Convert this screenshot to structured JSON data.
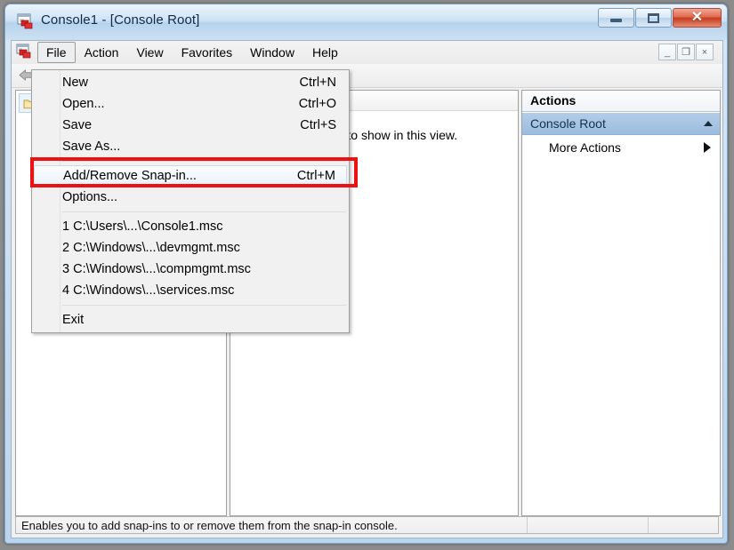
{
  "window": {
    "title": "Console1 - [Console Root]",
    "icon": "mmc-console-icon",
    "controls": {
      "minimize": "minimize-button",
      "maximize": "maximize-button",
      "close": "close-button"
    }
  },
  "mdi_controls": {
    "minimize": "_",
    "restore": "❐",
    "close": "×"
  },
  "menubar": {
    "items": [
      {
        "label": "File",
        "active": true
      },
      {
        "label": "Action",
        "active": false
      },
      {
        "label": "View",
        "active": false
      },
      {
        "label": "Favorites",
        "active": false
      },
      {
        "label": "Window",
        "active": false
      },
      {
        "label": "Help",
        "active": false
      }
    ]
  },
  "toolbar": {
    "back": "back-arrow-icon"
  },
  "file_menu": {
    "rows": [
      {
        "type": "item",
        "label": "New",
        "accel": "Ctrl+N",
        "highlight": false
      },
      {
        "type": "item",
        "label": "Open...",
        "accel": "Ctrl+O",
        "highlight": false
      },
      {
        "type": "item",
        "label": "Save",
        "accel": "Ctrl+S",
        "highlight": false
      },
      {
        "type": "item",
        "label": "Save As...",
        "accel": "",
        "highlight": false
      },
      {
        "type": "sep"
      },
      {
        "type": "item",
        "label": "Add/Remove Snap-in...",
        "accel": "Ctrl+M",
        "highlight": true
      },
      {
        "type": "item",
        "label": "Options...",
        "accel": "",
        "highlight": false
      },
      {
        "type": "sep"
      },
      {
        "type": "item",
        "label": "1 C:\\Users\\...\\Console1.msc",
        "accel": "",
        "highlight": false
      },
      {
        "type": "item",
        "label": "2 C:\\Windows\\...\\devmgmt.msc",
        "accel": "",
        "highlight": false
      },
      {
        "type": "item",
        "label": "3 C:\\Windows\\...\\compmgmt.msc",
        "accel": "",
        "highlight": false
      },
      {
        "type": "item",
        "label": "4 C:\\Windows\\...\\services.msc",
        "accel": "",
        "highlight": false
      },
      {
        "type": "sep"
      },
      {
        "type": "item",
        "label": "Exit",
        "accel": "",
        "highlight": false
      }
    ]
  },
  "tree_pane": {
    "root_icon": "folder-icon"
  },
  "result_pane": {
    "columns": [
      "",
      ""
    ],
    "empty_message": "There are no items to show in this view."
  },
  "actions_pane": {
    "title": "Actions",
    "group_label": "Console Root",
    "group_collapse_icon": "chevron-up-icon",
    "more_actions_label": "More Actions",
    "more_actions_icon": "chevron-right-icon"
  },
  "status_bar": {
    "message": "Enables you to add snap-ins to or remove them from the snap-in console.",
    "segment2": "",
    "segment3": ""
  },
  "annotation": {
    "highlight_color": "#ee1111",
    "target": "Add/Remove Snap-in..."
  }
}
